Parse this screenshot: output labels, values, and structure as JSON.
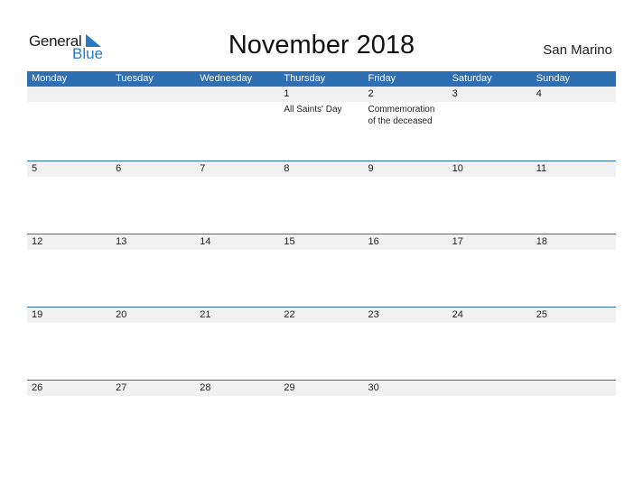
{
  "logo": {
    "general": "General",
    "blue": "Blue"
  },
  "title": "November 2018",
  "country": "San Marino",
  "colors": {
    "accent": "#2e6fb3",
    "strip": "#f1f1f1"
  },
  "weekdays": [
    "Monday",
    "Tuesday",
    "Wednesday",
    "Thursday",
    "Friday",
    "Saturday",
    "Sunday"
  ],
  "weeks": [
    {
      "days": [
        "",
        "",
        "",
        "1",
        "2",
        "3",
        "4"
      ],
      "events": [
        "",
        "",
        "",
        "All Saints' Day",
        "Commemoration of the deceased",
        "",
        ""
      ]
    },
    {
      "days": [
        "5",
        "6",
        "7",
        "8",
        "9",
        "10",
        "11"
      ],
      "events": [
        "",
        "",
        "",
        "",
        "",
        "",
        ""
      ]
    },
    {
      "days": [
        "12",
        "13",
        "14",
        "15",
        "16",
        "17",
        "18"
      ],
      "events": [
        "",
        "",
        "",
        "",
        "",
        "",
        ""
      ]
    },
    {
      "days": [
        "19",
        "20",
        "21",
        "22",
        "23",
        "24",
        "25"
      ],
      "events": [
        "",
        "",
        "",
        "",
        "",
        "",
        ""
      ]
    },
    {
      "days": [
        "26",
        "27",
        "28",
        "29",
        "30",
        "",
        ""
      ],
      "events": [
        "",
        "",
        "",
        "",
        "",
        "",
        ""
      ]
    }
  ]
}
